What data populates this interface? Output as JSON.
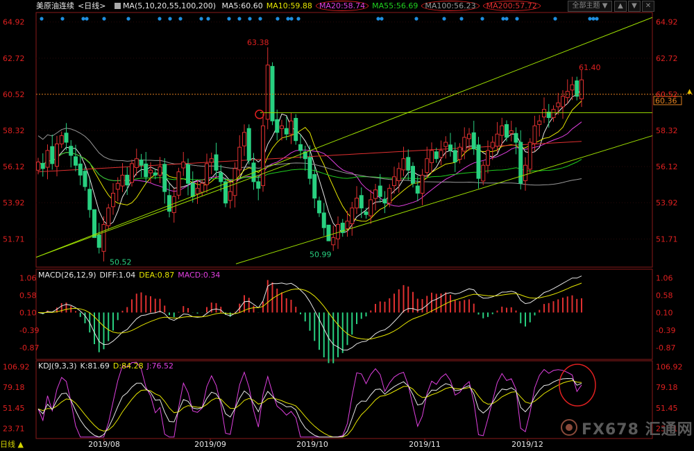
{
  "header": {
    "symbol": "美原油连续",
    "period": "<日线>",
    "ma_label": "MA(5,10,20,55,100,200)",
    "ma_values": [
      {
        "label": "MA5:60.60",
        "color": "#e8e8e8"
      },
      {
        "label": "MA10:59.88",
        "color": "#e6e600"
      },
      {
        "label": "MA20:58.74",
        "color": "#e040e0"
      },
      {
        "label": "MA55:56.69",
        "color": "#20d020"
      },
      {
        "label": "MA100:56.23",
        "color": "#9a9a9a"
      },
      {
        "label": "MA200:57.72",
        "color": "#e03030"
      }
    ]
  },
  "controls": {
    "theme_label": "全部主题",
    "theme_arrow": "▼",
    "scroll_up": "▲",
    "scroll_down": "▼",
    "close": "✕"
  },
  "price_axis": {
    "ticks": [
      "64.92",
      "62.72",
      "60.52",
      "58.32",
      "56.12",
      "53.92",
      "51.71"
    ],
    "current_price": "60.36"
  },
  "annotations": {
    "high": "63.38",
    "low1": "50.52",
    "low2": "50.99",
    "recent": "61.40"
  },
  "macd": {
    "label": "MACD(26,12,9)",
    "diff": "DIFF:1.04",
    "dea": "DEA:0.87",
    "macd": "MACD:0.34",
    "ticks": [
      "1.06",
      "0.58",
      "0.10",
      "-0.39",
      "-0.87"
    ]
  },
  "kdj": {
    "label": "KDJ(9,3,3)",
    "k": "K:81.69",
    "d": "D:84.28",
    "j": "J:76.52",
    "ticks": [
      "106.92",
      "79.18",
      "51.45",
      "23.71"
    ]
  },
  "date_axis": [
    "2019/08",
    "2019/09",
    "2019/10",
    "2019/11",
    "2019/12"
  ],
  "footer": {
    "label": "日线 ▲"
  },
  "watermark": {
    "text": "FX678 汇通网"
  },
  "chart_data": [
    {
      "type": "candlestick",
      "title": "美原油连续 <日线>",
      "ylim": [
        50.0,
        65.5
      ],
      "y_ticks": [
        64.92,
        62.72,
        60.52,
        58.32,
        56.12,
        53.92,
        51.71
      ],
      "x_labels": [
        "2019/08",
        "2019/09",
        "2019/10",
        "2019/11",
        "2019/12"
      ],
      "close": [
        56.4,
        56.0,
        57.1,
        56.3,
        57.5,
        58.0,
        57.6,
        56.8,
        56.2,
        55.6,
        54.9,
        53.5,
        51.8,
        51.2,
        52.6,
        53.6,
        54.5,
        55.1,
        55.6,
        55.0,
        56.3,
        56.6,
        56.2,
        55.5,
        55.9,
        55.6,
        56.1,
        54.6,
        53.4,
        54.3,
        55.8,
        56.4,
        55.1,
        54.3,
        54.8,
        55.1,
        56.3,
        56.6,
        55.9,
        55.2,
        53.9,
        54.6,
        56.0,
        57.3,
        58.2,
        56.5,
        55.2,
        54.8,
        58.6,
        62.3,
        58.9,
        58.2,
        58.6,
        58.1,
        58.9,
        57.7,
        57.1,
        56.6,
        55.4,
        54.2,
        53.3,
        52.4,
        51.6,
        51.8,
        52.6,
        52.1,
        52.8,
        53.6,
        54.2,
        53.6,
        53.2,
        54.1,
        54.7,
        54.3,
        53.9,
        54.8,
        55.5,
        56.0,
        56.6,
        55.9,
        55.1,
        54.5,
        55.6,
        56.6,
        57.1,
        56.6,
        57.1,
        57.6,
        57.1,
        56.4,
        57.3,
        57.9,
        58.1,
        57.2,
        55.4,
        56.2,
        57.1,
        57.6,
        58.1,
        58.6,
        57.9,
        58.3,
        57.6,
        55.1,
        56.2,
        57.6,
        58.6,
        58.9,
        59.6,
        59.1,
        59.6,
        60.0,
        60.4,
        60.7,
        61.1,
        60.4,
        61.4
      ],
      "ma_colors": {
        "MA5": "#e8e8e8",
        "MA10": "#e6e600",
        "MA20": "#e040e0",
        "MA55": "#20d020",
        "MA100": "#9a9a9a",
        "MA200": "#e03030"
      }
    },
    {
      "type": "bar",
      "title": "MACD(26,12,9)",
      "ylim": [
        -1.2,
        1.3
      ],
      "y_ticks": [
        1.06,
        0.58,
        0.1,
        -0.39,
        -0.87
      ],
      "series": [
        {
          "name": "DIFF",
          "value": 1.04
        },
        {
          "name": "DEA",
          "value": 0.87
        },
        {
          "name": "MACD",
          "value": 0.34
        }
      ]
    },
    {
      "type": "line",
      "title": "KDJ(9,3,3)",
      "ylim": [
        10,
        115
      ],
      "y_ticks": [
        106.92,
        79.18,
        51.45,
        23.71
      ],
      "series": [
        {
          "name": "K",
          "value": 81.69
        },
        {
          "name": "D",
          "value": 84.28
        },
        {
          "name": "J",
          "value": 76.52
        }
      ]
    }
  ]
}
